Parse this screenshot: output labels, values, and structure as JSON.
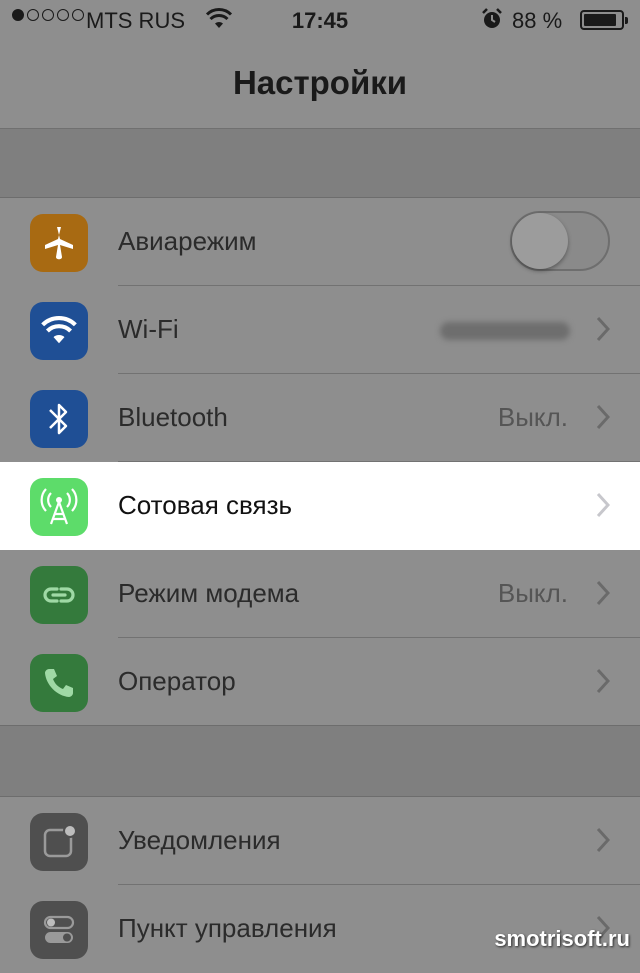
{
  "status_bar": {
    "signal_dots_filled": 1,
    "signal_dots_total": 5,
    "carrier": "MTS RUS",
    "time": "17:45",
    "battery_percent": "88 %",
    "battery_level": 0.88,
    "icons": [
      "wifi-icon",
      "alarm-icon",
      "battery-icon"
    ]
  },
  "navbar": {
    "title": "Настройки"
  },
  "group1": [
    {
      "label": "Авиарежим",
      "icon": "airplane-icon",
      "icon_color": "#a86a12",
      "control": "toggle",
      "toggle_on": false
    },
    {
      "label": "Wi-Fi",
      "icon": "wifi-icon",
      "icon_color": "#1f4f95",
      "value_obscured": true
    },
    {
      "label": "Bluetooth",
      "icon": "bluetooth-icon",
      "icon_color": "#1f4f95",
      "value": "Выкл."
    },
    {
      "label": "Сотовая связь",
      "icon": "cellular-antenna-icon",
      "icon_color": "#5ddc6a",
      "highlighted": true
    },
    {
      "label": "Режим модема",
      "icon": "personal-hotspot-icon",
      "icon_color": "#347a3c",
      "value": "Выкл."
    },
    {
      "label": "Оператор",
      "icon": "phone-icon",
      "icon_color": "#347a3c"
    }
  ],
  "group2": [
    {
      "label": "Уведомления",
      "icon": "notifications-icon",
      "icon_color": "#4f4f4f"
    },
    {
      "label": "Пункт управления",
      "icon": "control-center-icon",
      "icon_color": "#4f4f4f"
    }
  ],
  "watermark": "smotrisoft.ru"
}
